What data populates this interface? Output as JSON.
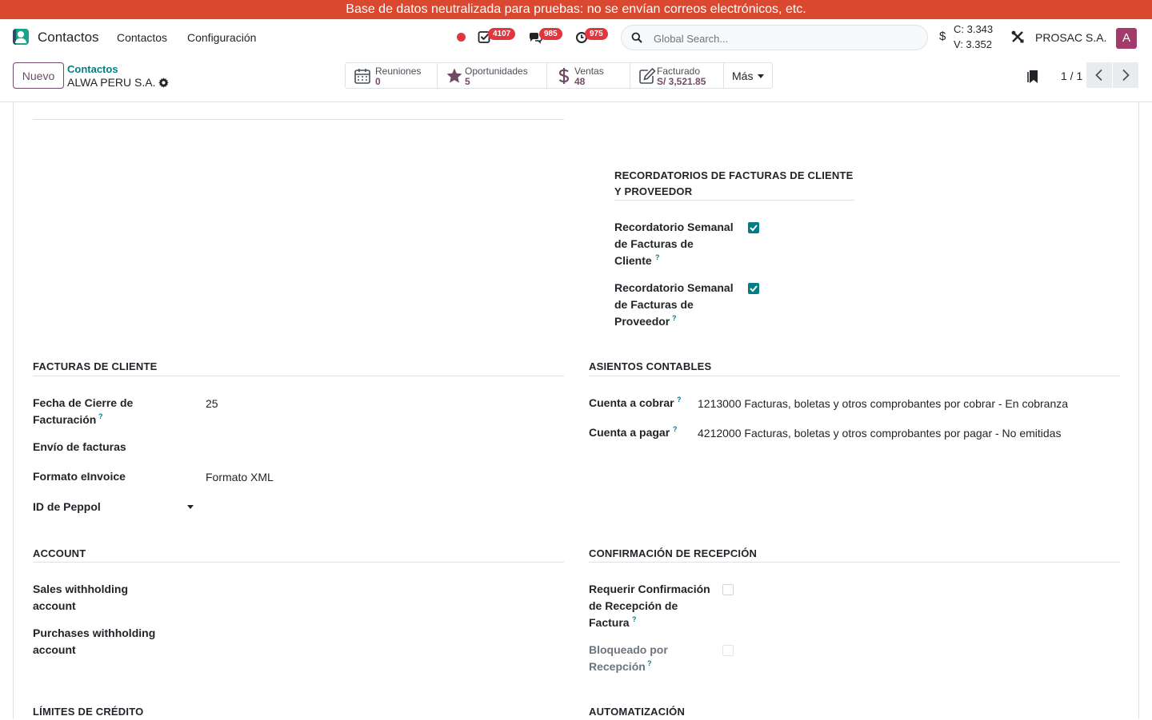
{
  "banner": {
    "text": "Base de datos neutralizada para pruebas: no se envían correos electrónicos, etc."
  },
  "navbar": {
    "app_name": "Contactos",
    "menus": [
      "Contactos",
      "Configuración"
    ],
    "activities_count": "4107",
    "messages_count": "985",
    "timer_count": "975",
    "search_placeholder": "Global Search...",
    "currency_symbol": "$",
    "rate_buy": "C: 3.343",
    "rate_sell": "V: 3.352",
    "company": "PROSAC S.A.",
    "avatar_initial": "A"
  },
  "control": {
    "new_button": "Nuevo",
    "breadcrumb": "Contactos",
    "record_name": "ALWA PERU S.A.",
    "stats": [
      {
        "label": "Reuniones",
        "value": "0",
        "icon": "calendar-icon"
      },
      {
        "label": "Oportunidades",
        "value": "5",
        "icon": "star-icon"
      },
      {
        "label": "Ventas",
        "value": "48",
        "icon": "dollar-icon"
      },
      {
        "label": "Facturado",
        "value": "S/ 3,521.85",
        "icon": "invoice-edit-icon"
      }
    ],
    "more": "Más",
    "pager": "1 / 1"
  },
  "form": {
    "reminders": {
      "title_line1": "RECORDATORIOS DE FACTURAS DE CLIENTE",
      "title_line2": "Y PROVEEDOR",
      "customer_label": [
        "Recordatorio Semanal",
        "de Facturas de",
        "Cliente"
      ],
      "customer_checked": true,
      "vendor_label": [
        "Recordatorio Semanal",
        "de Facturas de",
        "Proveedor"
      ],
      "vendor_checked": true
    },
    "customer_invoices": {
      "title": "FACTURAS DE CLIENTE",
      "closing_label": [
        "Fecha de Cierre de",
        "Facturación"
      ],
      "closing_value": "25",
      "sending_label": "Envío de facturas",
      "einvoice_label": "Formato eInvoice",
      "einvoice_value": "Formato XML",
      "peppol_label": "ID de Peppol"
    },
    "journal": {
      "title": "ASIENTOS CONTABLES",
      "receivable_label": "Cuenta a cobrar",
      "receivable_value": "1213000 Facturas, boletas y otros comprobantes por cobrar - En cobranza",
      "payable_label": "Cuenta a pagar",
      "payable_value": "4212000 Facturas, boletas y otros comprobantes por pagar - No emitidas"
    },
    "account": {
      "title": "ACCOUNT",
      "sales_label": [
        "Sales withholding",
        "account"
      ],
      "purchases_label": [
        "Purchases withholding",
        "account"
      ]
    },
    "reception": {
      "title": "CONFIRMACIÓN DE RECEPCIÓN",
      "require_label": [
        "Requerir Confirmación",
        "de Recepción de",
        "Factura"
      ],
      "require_checked": false,
      "blocked_label": [
        "Bloqueado por",
        "Recepción"
      ],
      "blocked_checked": false
    },
    "credit": {
      "title": "LÍMITES DE CRÉDITO"
    },
    "automation": {
      "title": "AUTOMATIZACIÓN"
    },
    "help_mark": "?"
  },
  "colors": {
    "banner": "#d9482f",
    "primary": "#714b67",
    "accent": "#017e84",
    "badge": "#e0373e"
  }
}
